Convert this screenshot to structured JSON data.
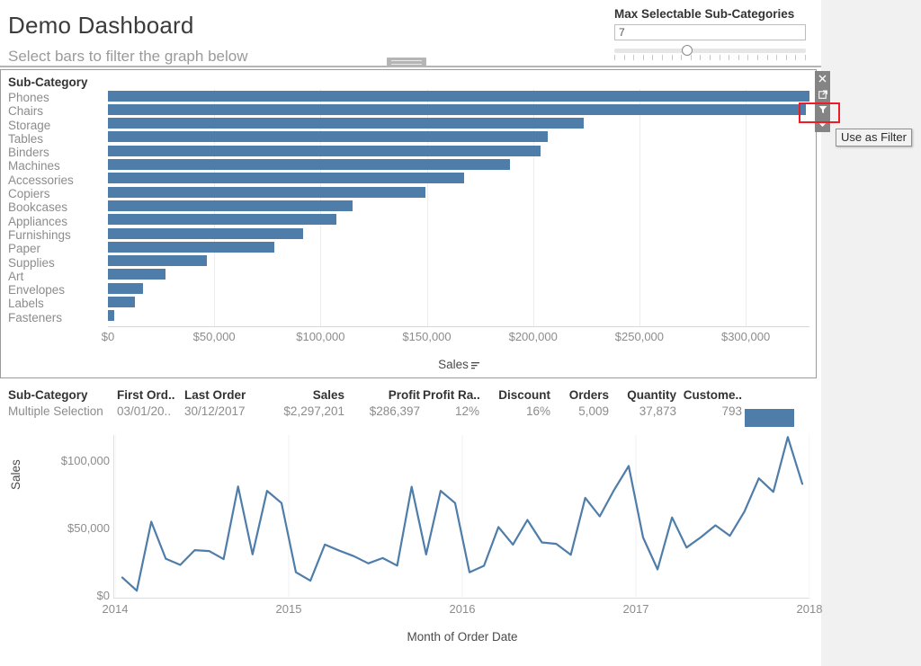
{
  "dashboard": {
    "title": "Demo Dashboard",
    "subtitle": "Select bars to filter the graph below"
  },
  "parameter": {
    "label": "Max Selectable Sub-Categories",
    "value": "7",
    "slider_percent": 38,
    "tick_count": 21
  },
  "toolbar": {
    "close_title": "Close",
    "popout_title": "Open in new window",
    "filter_title": "Use as Filter",
    "more_title": "More options",
    "tooltip_text": "Use as Filter",
    "highlight_color": "#ee1c25"
  },
  "bar_chart": {
    "header": "Sub-Category",
    "axis_title": "Sales",
    "bar_color": "#4f7daa"
  },
  "summary_table": {
    "columns": [
      {
        "header": "Sub-Category",
        "value": "Multiple Selection"
      },
      {
        "header": "First Ord..",
        "value": "03/01/20.."
      },
      {
        "header": "Last Order",
        "value": "30/12/2017"
      },
      {
        "header": "Sales",
        "value": "$2,297,201"
      },
      {
        "header": "Profit",
        "value": "$286,397"
      },
      {
        "header": "Profit Ra..",
        "value": "12%"
      },
      {
        "header": "Discount",
        "value": "16%"
      },
      {
        "header": "Orders",
        "value": "5,009"
      },
      {
        "header": "Quantity",
        "value": "37,873"
      },
      {
        "header": "Custome..",
        "value": "793"
      }
    ]
  },
  "line_chart": {
    "ylabel": "Sales",
    "xlabel": "Month of Order Date",
    "line_color": "#4f7daa"
  },
  "chart_data": [
    {
      "type": "bar",
      "title": "Sub-Category",
      "xlabel": "Sales",
      "ylabel": "Sub-Category",
      "orientation": "horizontal",
      "xlim": [
        0,
        330000
      ],
      "xticks": [
        0,
        50000,
        100000,
        150000,
        200000,
        250000,
        300000
      ],
      "xtick_labels": [
        "$0",
        "$50,000",
        "$100,000",
        "$150,000",
        "$200,000",
        "$250,000",
        "$300,000"
      ],
      "grid": true,
      "categories": [
        "Phones",
        "Chairs",
        "Storage",
        "Tables",
        "Binders",
        "Machines",
        "Accessories",
        "Copiers",
        "Bookcases",
        "Appliances",
        "Furnishings",
        "Paper",
        "Supplies",
        "Art",
        "Envelopes",
        "Labels",
        "Fasteners"
      ],
      "values": [
        330007,
        328449,
        223844,
        206966,
        203413,
        189239,
        167380,
        149528,
        114880,
        107532,
        91705,
        78479,
        46674,
        27119,
        16476,
        12486,
        3024
      ]
    },
    {
      "type": "line",
      "title": "",
      "xlabel": "Month of Order Date",
      "ylabel": "Sales",
      "ylim": [
        0,
        120000
      ],
      "yticks": [
        0,
        50000,
        100000
      ],
      "ytick_labels": [
        "$0",
        "$50,000",
        "$100,000"
      ],
      "xticks": [
        "2014",
        "2015",
        "2016",
        "2017",
        "2018"
      ],
      "grid": true,
      "x": [
        "2014-01",
        "2014-02",
        "2014-03",
        "2014-04",
        "2014-05",
        "2014-06",
        "2014-07",
        "2014-08",
        "2014-09",
        "2014-10",
        "2014-11",
        "2014-12",
        "2015-01",
        "2015-02",
        "2015-03",
        "2015-04",
        "2015-05",
        "2015-06",
        "2015-07",
        "2015-08",
        "2015-09",
        "2015-10",
        "2015-11",
        "2015-12",
        "2016-01",
        "2016-02",
        "2016-03",
        "2016-04",
        "2016-05",
        "2016-06",
        "2016-07",
        "2016-08",
        "2016-09",
        "2016-10",
        "2016-11",
        "2016-12",
        "2017-01",
        "2017-02",
        "2017-03",
        "2017-04",
        "2017-05",
        "2017-06",
        "2017-07",
        "2017-08",
        "2017-09",
        "2017-10",
        "2017-11",
        "2017-12"
      ],
      "values": [
        14237,
        4520,
        55691,
        28295,
        23648,
        34595,
        33946,
        27909,
        81777,
        31453,
        78629,
        69545,
        18174,
        11951,
        38726,
        34196,
        30132,
        24797,
        28765,
        23110,
        81623,
        31404,
        78628,
        69545,
        18174,
        22979,
        51715,
        38750,
        56987,
        40344,
        39261,
        31115,
        73410,
        59687,
        79412,
        96999,
        43971,
        20301,
        58872,
        36522,
        44261,
        52982,
        45264,
        63121,
        87867,
        77777,
        118448,
        83829
      ]
    }
  ]
}
